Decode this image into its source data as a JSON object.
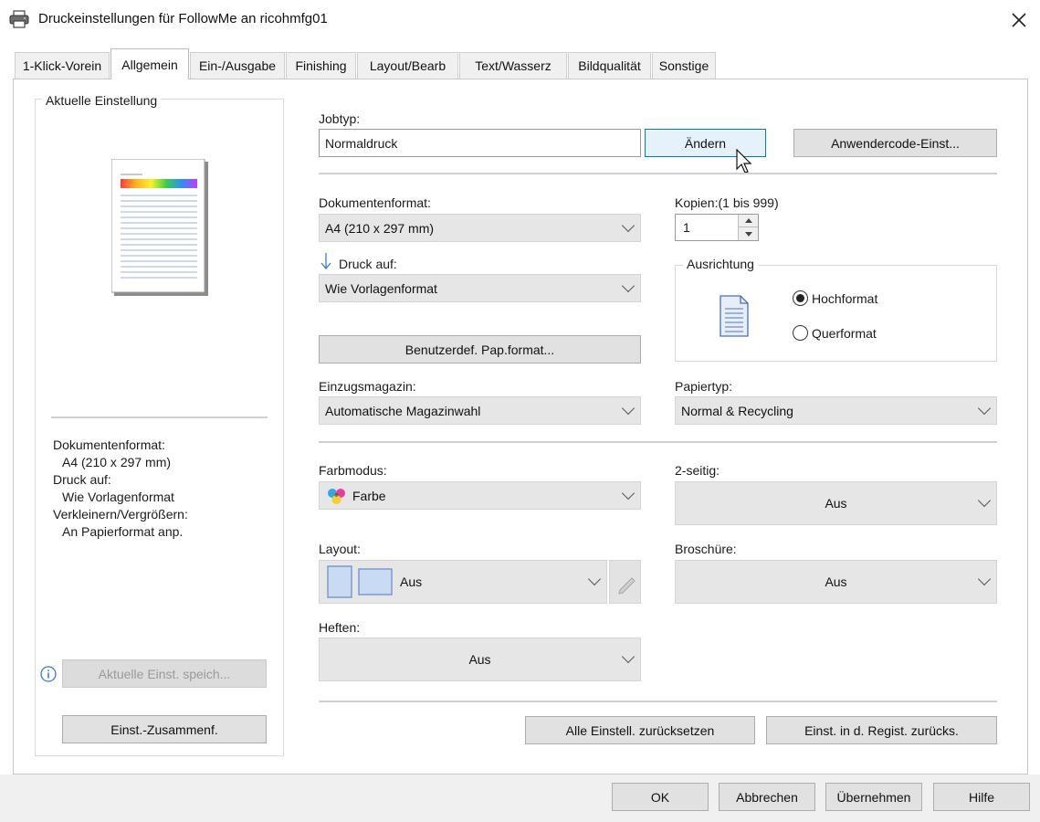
{
  "window": {
    "title": "Druckeinstellungen für FollowMe an ricohmfg01"
  },
  "tabs": [
    {
      "label": "1-Klick-Vorein"
    },
    {
      "label": "Allgemein"
    },
    {
      "label": "Ein-/Ausgabe"
    },
    {
      "label": "Finishing"
    },
    {
      "label": "Layout/Bearb"
    },
    {
      "label": "Text/Wasserz"
    },
    {
      "label": "Bildqualität"
    },
    {
      "label": "Sonstige"
    }
  ],
  "left": {
    "title": "Aktuelle Einstellung",
    "summary": {
      "docformat_label": "Dokumentenformat:",
      "docformat_value": "A4 (210 x 297 mm)",
      "druckauf_label": "Druck auf:",
      "druckauf_value": "Wie Vorlagenformat",
      "scale_label": "Verkleinern/Vergrößern:",
      "scale_value": "An Papierformat anp."
    },
    "save_button": "Aktuelle Einst. speich...",
    "summary_button": "Einst.-Zusammenf."
  },
  "jobtype": {
    "label": "Jobtyp:",
    "value": "Normaldruck",
    "change_button": "Ändern",
    "usercode_button": "Anwendercode-Einst..."
  },
  "docformat": {
    "label": "Dokumentenformat:",
    "value": "A4 (210 x 297 mm)"
  },
  "copies": {
    "label": "Kopien:(1 bis 999)",
    "value": "1"
  },
  "printon": {
    "label": "Druck auf:",
    "value": "Wie Vorlagenformat"
  },
  "custom_paper_button": "Benutzerdef. Pap.format...",
  "orientation": {
    "label": "Ausrichtung",
    "portrait": "Hochformat",
    "landscape": "Querformat",
    "selected": "portrait"
  },
  "tray": {
    "label": "Einzugsmagazin:",
    "value": "Automatische Magazinwahl"
  },
  "papertype": {
    "label": "Papiertyp:",
    "value": "Normal & Recycling"
  },
  "colormode": {
    "label": "Farbmodus:",
    "value": "Farbe"
  },
  "duplex": {
    "label": "2-seitig:",
    "value": "Aus"
  },
  "layout": {
    "label": "Layout:",
    "value": "Aus"
  },
  "brochure": {
    "label": "Broschüre:",
    "value": "Aus"
  },
  "staple": {
    "label": "Heften:",
    "value": "Aus"
  },
  "reset_all_button": "Alle Einstell. zurücksetzen",
  "reset_registry_button": "Einst. in d. Regist. zurücks.",
  "footer": {
    "ok": "OK",
    "cancel": "Abbrechen",
    "apply": "Übernehmen",
    "help": "Hilfe"
  },
  "colors": {
    "accent": "#0078d7",
    "button_face": "#e1e1e1",
    "combo_face": "#e6e6e6"
  }
}
